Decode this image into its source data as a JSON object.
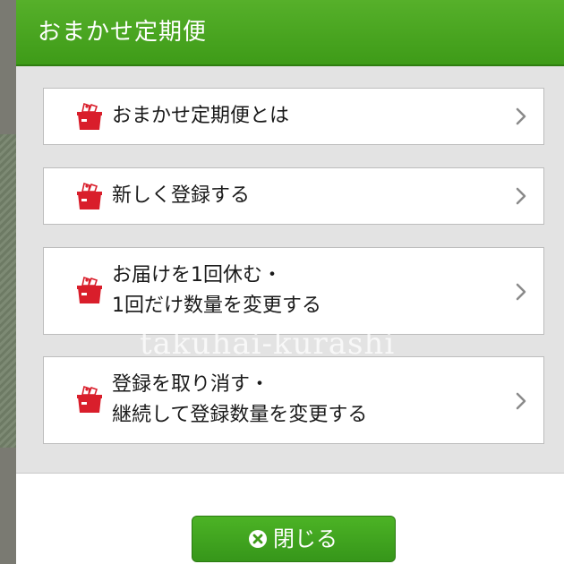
{
  "modal": {
    "title": "おまかせ定期便",
    "accent_color": "#3e9b18",
    "icon_name": "gift-box-icon",
    "icon_color": "#d91e2b",
    "items": [
      {
        "lines": [
          "おまかせ定期便とは"
        ]
      },
      {
        "lines": [
          "新しく登録する"
        ]
      },
      {
        "lines": [
          "お届けを1回休む・",
          "1回だけ数量を変更する"
        ]
      },
      {
        "lines": [
          "登録を取り消す・",
          "継続して登録数量を変更する"
        ]
      }
    ],
    "close_label": "閉じる"
  },
  "watermark": "takuhai-kurashi"
}
